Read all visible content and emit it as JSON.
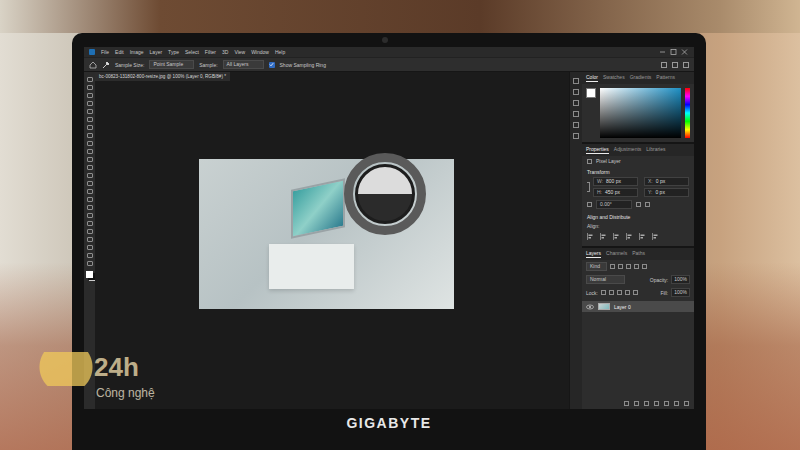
{
  "photo": {
    "brand": "GIGABYTE",
    "watermark": {
      "mark": "24h",
      "caption": "Công nghệ"
    }
  },
  "menu": [
    "File",
    "Edit",
    "Image",
    "Layer",
    "Type",
    "Select",
    "Filter",
    "3D",
    "View",
    "Window",
    "Help"
  ],
  "options_bar": {
    "sample_size_label": "Sample Size:",
    "sample_size": "Point Sample",
    "sample_label": "Sample:",
    "sample": "All Layers",
    "sampling_ring": {
      "label": "Show Sampling Ring",
      "checked": true
    }
  },
  "document_tab": {
    "title": "bc-00823-131802-800-resize.jpg @ 100% (Layer 0, RGB/8#) *"
  },
  "color_panel": {
    "tabs": [
      {
        "label": "Color",
        "selected": true
      },
      {
        "label": "Swatches",
        "selected": false
      },
      {
        "label": "Gradients",
        "selected": false
      },
      {
        "label": "Patterns",
        "selected": false
      }
    ]
  },
  "properties_panel": {
    "tabs": [
      {
        "label": "Properties",
        "selected": true
      },
      {
        "label": "Adjustments",
        "selected": false
      },
      {
        "label": "Libraries",
        "selected": false
      }
    ],
    "layer_kind": "Pixel Layer",
    "transform_title": "Transform",
    "fields": [
      {
        "label": "W:",
        "value": "800 px"
      },
      {
        "label": "X:",
        "value": "0 px"
      },
      {
        "label": "H:",
        "value": "450 px"
      },
      {
        "label": "Y:",
        "value": "0 px"
      }
    ],
    "angle": "0.00°",
    "align_title": "Align and Distribute",
    "align_label": "Align:"
  },
  "layers_panel": {
    "tabs": [
      {
        "label": "Layers",
        "selected": true
      },
      {
        "label": "Channels",
        "selected": false
      },
      {
        "label": "Paths",
        "selected": false
      }
    ],
    "filter": "Kind",
    "blend_mode": "Normal",
    "opacity_label": "Opacity:",
    "opacity": "100%",
    "lock_label": "Lock:",
    "fill_label": "Fill:",
    "fill": "100%",
    "layers": [
      {
        "name": "Layer 0",
        "visible": true,
        "selected": true
      }
    ]
  }
}
